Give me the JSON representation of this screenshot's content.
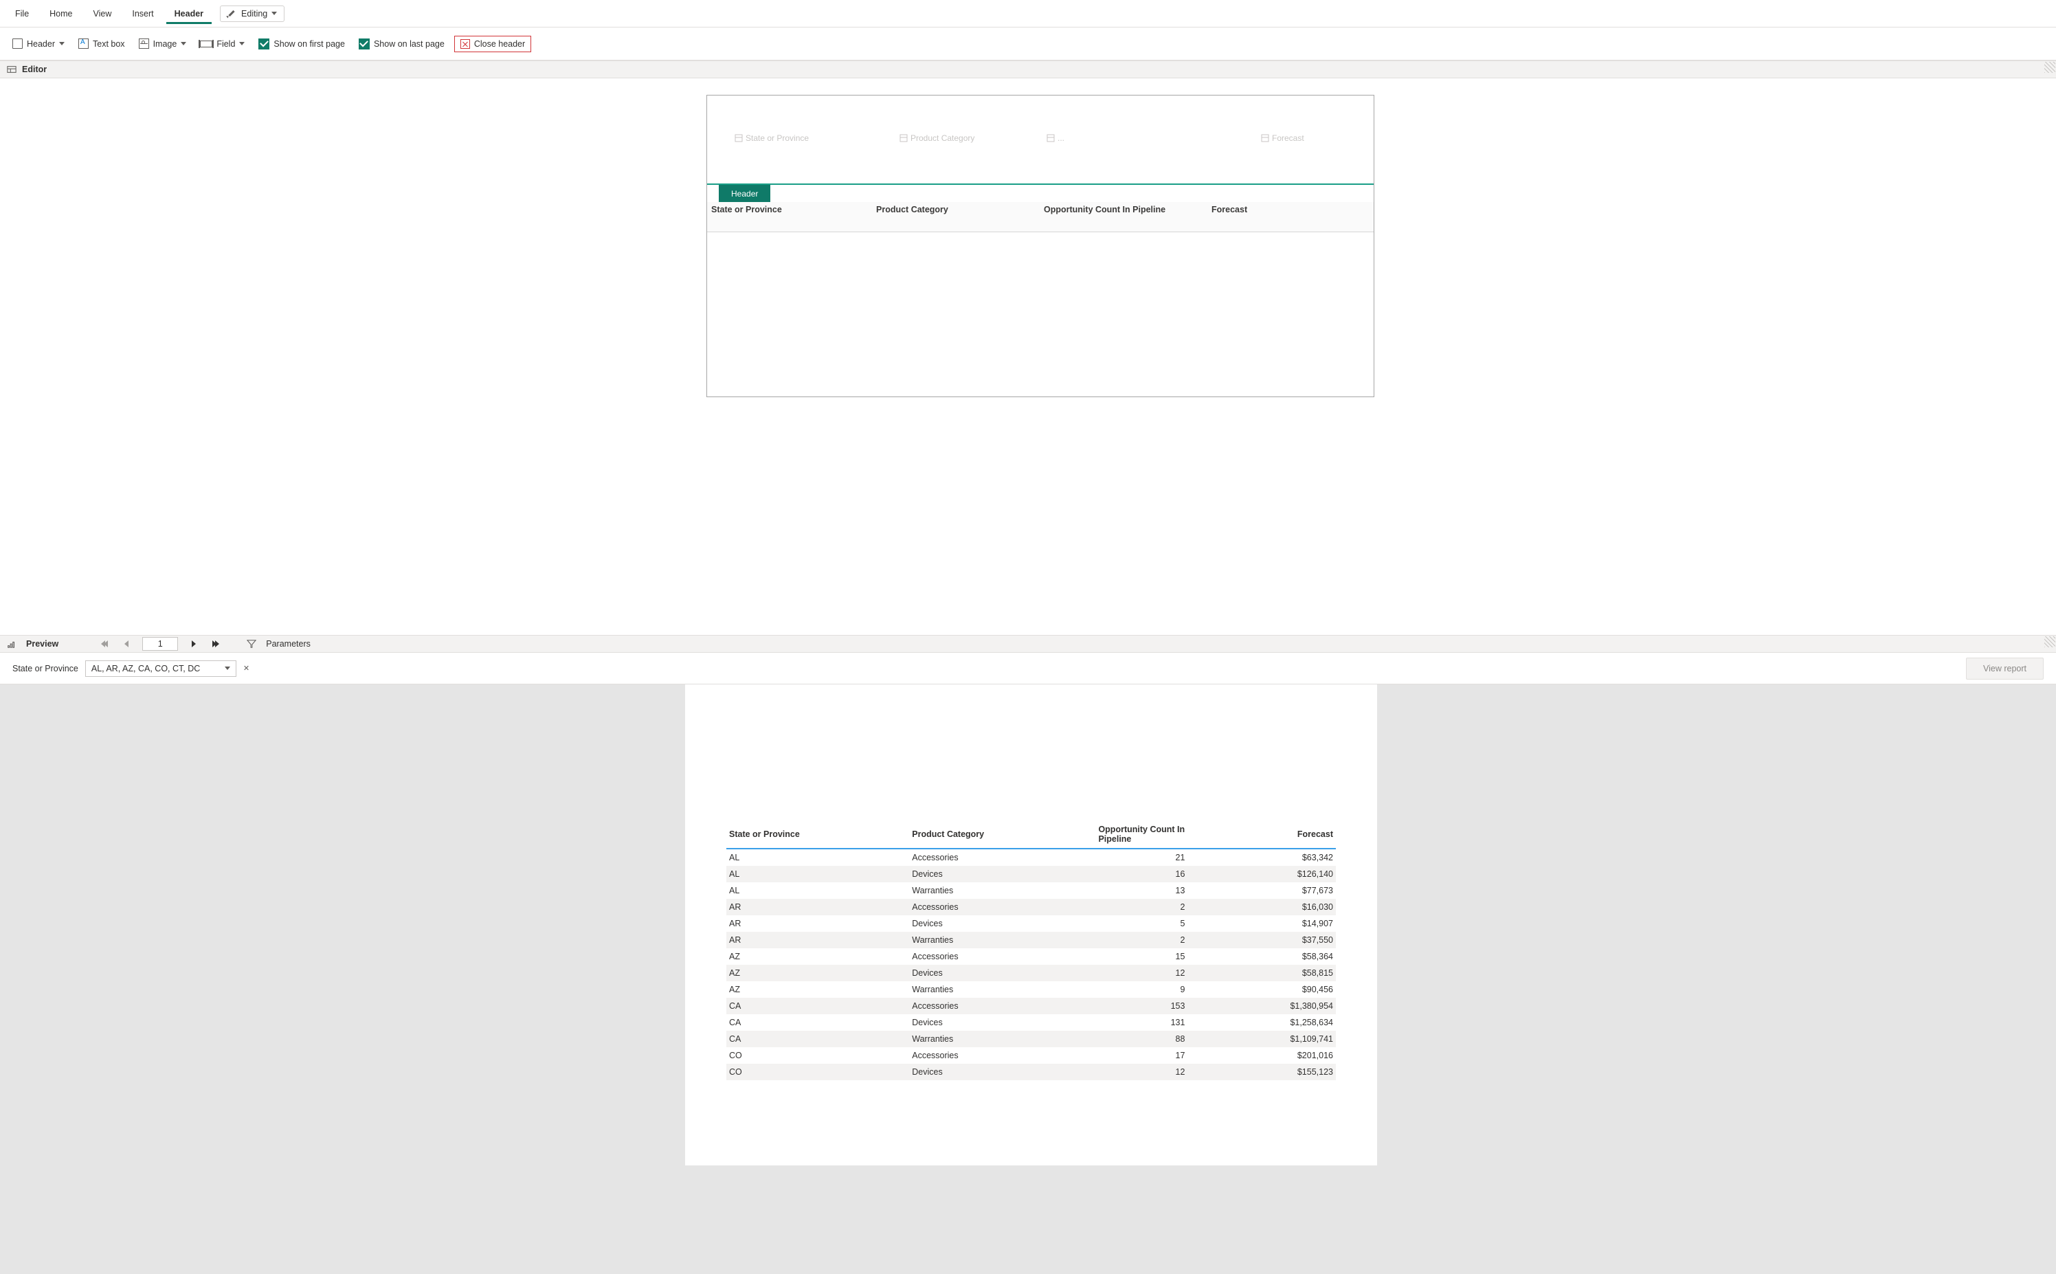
{
  "menu": {
    "tabs": [
      "File",
      "Home",
      "View",
      "Insert",
      "Header"
    ],
    "active": "Header",
    "editing": "Editing"
  },
  "ribbon": {
    "header": "Header",
    "textbox": "Text box",
    "image": "Image",
    "field": "Field",
    "show_first": "Show on first page",
    "show_last": "Show on last page",
    "close_header": "Close header"
  },
  "sections": {
    "editor": "Editor",
    "preview": "Preview",
    "parameters": "Parameters"
  },
  "design": {
    "header_tab": "Header",
    "cols": [
      "State or Province",
      "Product Category",
      "Opportunity Count In Pipeline",
      "Forecast"
    ],
    "placeholders": [
      "State or Province",
      "Product Category",
      "...",
      "Forecast"
    ]
  },
  "preview_nav": {
    "page": "1"
  },
  "params": {
    "label": "State or Province",
    "value": "AL, AR, AZ, CA, CO, CT, DC",
    "view_report": "View report"
  },
  "report": {
    "headers": [
      "State or Province",
      "Product Category",
      "Opportunity Count In Pipeline",
      "Forecast"
    ],
    "rows": [
      [
        "AL",
        "Accessories",
        "21",
        "$63,342"
      ],
      [
        "AL",
        "Devices",
        "16",
        "$126,140"
      ],
      [
        "AL",
        "Warranties",
        "13",
        "$77,673"
      ],
      [
        "AR",
        "Accessories",
        "2",
        "$16,030"
      ],
      [
        "AR",
        "Devices",
        "5",
        "$14,907"
      ],
      [
        "AR",
        "Warranties",
        "2",
        "$37,550"
      ],
      [
        "AZ",
        "Accessories",
        "15",
        "$58,364"
      ],
      [
        "AZ",
        "Devices",
        "12",
        "$58,815"
      ],
      [
        "AZ",
        "Warranties",
        "9",
        "$90,456"
      ],
      [
        "CA",
        "Accessories",
        "153",
        "$1,380,954"
      ],
      [
        "CA",
        "Devices",
        "131",
        "$1,258,634"
      ],
      [
        "CA",
        "Warranties",
        "88",
        "$1,109,741"
      ],
      [
        "CO",
        "Accessories",
        "17",
        "$201,016"
      ],
      [
        "CO",
        "Devices",
        "12",
        "$155,123"
      ]
    ]
  }
}
